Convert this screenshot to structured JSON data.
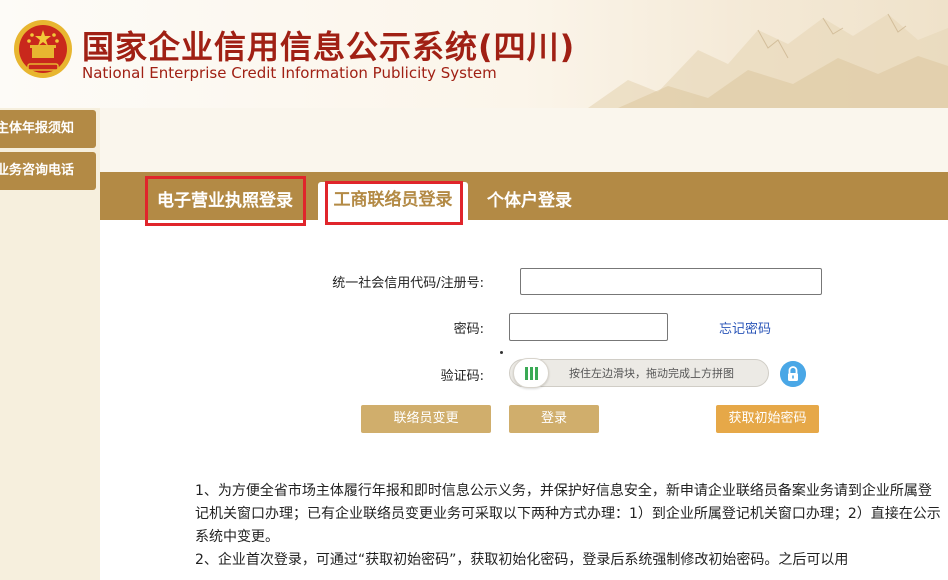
{
  "header": {
    "title_cn": "国家企业信用信息公示系统(四川)",
    "title_en": "National Enterprise Credit Information Publicity System"
  },
  "sidebar": {
    "items": [
      {
        "label": "主体年报须知"
      },
      {
        "label": "业务咨询电话"
      }
    ]
  },
  "tabs": [
    {
      "label": "电子营业执照登录",
      "highlighted": true,
      "active": false
    },
    {
      "label": "工商联络员登录",
      "highlighted": true,
      "active": true
    },
    {
      "label": "个体户登录",
      "highlighted": false,
      "active": false
    }
  ],
  "form": {
    "credit_code_label": "统一社会信用代码/注册号:",
    "credit_code_value": "",
    "password_label": "密码:",
    "password_value": "",
    "forgot_password": "忘记密码",
    "captcha_label": "验证码:",
    "slider_hint": "按住左边滑块，拖动完成上方拼图"
  },
  "buttons": {
    "change_contact": "联络员变更",
    "login": "登录",
    "get_initial_password": "获取初始密码"
  },
  "notice": {
    "p1": "1、为方便全省市场主体履行年报和即时信息公示义务，并保护好信息安全，新申请企业联络员备案业务请到企业所属登记机关窗口办理；已有企业联络员变更业务可采取以下两种方式办理：1）到企业所属登记机关窗口办理；2）直接在公示系统中变更。",
    "p2": "2、企业首次登录，可通过“获取初始密码”，获取初始化密码，登录后系统强制修改初始密码。之后可以用"
  },
  "colors": {
    "brand_brown": "#b38a45",
    "title_red": "#a02014",
    "highlight_red": "#e0252b",
    "button_tan": "#d0ae6c",
    "button_orange": "#e6a848",
    "link_blue": "#2a55b8"
  }
}
